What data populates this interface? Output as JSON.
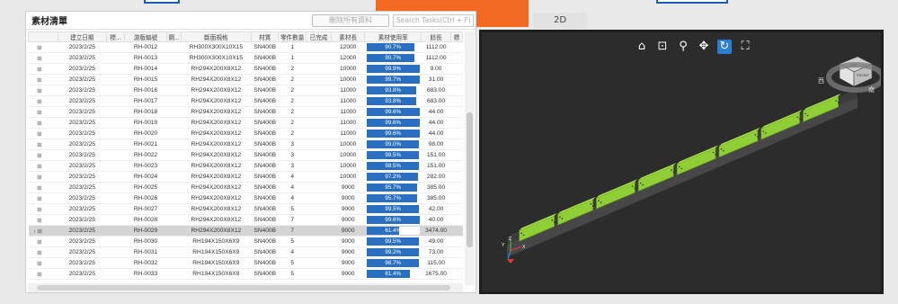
{
  "panel": {
    "title": "素材清單",
    "delete_button": "刪除所有資料",
    "search_placeholder": "Search Tasks(Ctrl + F)"
  },
  "columns": [
    "建立日期",
    "標...",
    "游版編號",
    "鋼...",
    "斷面規格",
    "材質",
    "零件數量",
    "已完成",
    "素材長",
    "素材使用率",
    "餘長",
    "標"
  ],
  "rows": [
    {
      "date": "2023/2/25",
      "id": "RH-0012",
      "spec": "RH300X300X10X15",
      "mat": "SN400B",
      "qty": "1",
      "len": "12000",
      "rate": "90.7%",
      "rate_value": 90.7,
      "rem": "1112.00"
    },
    {
      "date": "2023/2/25",
      "id": "RH-0013",
      "spec": "RH300X300X10X15",
      "mat": "SN400B",
      "qty": "1",
      "len": "12000",
      "rate": "90.7%",
      "rate_value": 90.7,
      "rem": "1112.00"
    },
    {
      "date": "2023/2/25",
      "id": "RH-0014",
      "spec": "RH294X200X8X12",
      "mat": "SN400B",
      "qty": "2",
      "len": "10000",
      "rate": "99.9%",
      "rate_value": 99.9,
      "rem": "9.00"
    },
    {
      "date": "2023/2/25",
      "id": "RH-0015",
      "spec": "RH294X200X8X12",
      "mat": "SN400B",
      "qty": "2",
      "len": "10000",
      "rate": "99.7%",
      "rate_value": 99.7,
      "rem": "31.00"
    },
    {
      "date": "2023/2/25",
      "id": "RH-0016",
      "spec": "RH294X200X8X12",
      "mat": "SN400B",
      "qty": "2",
      "len": "11000",
      "rate": "93.8%",
      "rate_value": 93.8,
      "rem": "683.00"
    },
    {
      "date": "2023/2/25",
      "id": "RH-0017",
      "spec": "RH294X200X8X12",
      "mat": "SN400B",
      "qty": "2",
      "len": "11000",
      "rate": "93.8%",
      "rate_value": 93.8,
      "rem": "683.00"
    },
    {
      "date": "2023/2/25",
      "id": "RH-0018",
      "spec": "RH294X200X8X12",
      "mat": "SN400B",
      "qty": "2",
      "len": "11000",
      "rate": "99.6%",
      "rate_value": 99.6,
      "rem": "44.00"
    },
    {
      "date": "2023/2/25",
      "id": "RH-0019",
      "spec": "RH294X200X8X12",
      "mat": "SN400B",
      "qty": "2",
      "len": "11000",
      "rate": "99.6%",
      "rate_value": 99.6,
      "rem": "44.00"
    },
    {
      "date": "2023/2/25",
      "id": "RH-0020",
      "spec": "RH294X200X8X12",
      "mat": "SN400B",
      "qty": "2",
      "len": "11000",
      "rate": "99.6%",
      "rate_value": 99.6,
      "rem": "44.00"
    },
    {
      "date": "2023/2/25",
      "id": "RH-0021",
      "spec": "RH294X200X8X12",
      "mat": "SN400B",
      "qty": "3",
      "len": "10000",
      "rate": "99.0%",
      "rate_value": 99.0,
      "rem": "98.00"
    },
    {
      "date": "2023/2/25",
      "id": "RH-0022",
      "spec": "RH294X200X8X12",
      "mat": "SN400B",
      "qty": "3",
      "len": "10000",
      "rate": "98.5%",
      "rate_value": 98.5,
      "rem": "151.00"
    },
    {
      "date": "2023/2/25",
      "id": "RH-0023",
      "spec": "RH294X200X8X12",
      "mat": "SN400B",
      "qty": "3",
      "len": "10000",
      "rate": "98.5%",
      "rate_value": 98.5,
      "rem": "151.00"
    },
    {
      "date": "2023/2/25",
      "id": "RH-0024",
      "spec": "RH294X200X8X12",
      "mat": "SN400B",
      "qty": "4",
      "len": "10000",
      "rate": "97.2%",
      "rate_value": 97.2,
      "rem": "282.00"
    },
    {
      "date": "2023/2/25",
      "id": "RH-0025",
      "spec": "RH294X200X8X12",
      "mat": "SN400B",
      "qty": "4",
      "len": "9000",
      "rate": "95.7%",
      "rate_value": 95.7,
      "rem": "385.00"
    },
    {
      "date": "2023/2/25",
      "id": "RH-0026",
      "spec": "RH294X200X8X12",
      "mat": "SN400B",
      "qty": "4",
      "len": "9000",
      "rate": "95.7%",
      "rate_value": 95.7,
      "rem": "385.00"
    },
    {
      "date": "2023/2/25",
      "id": "RH-0027",
      "spec": "RH294X200X8X12",
      "mat": "SN400B",
      "qty": "5",
      "len": "9000",
      "rate": "99.5%",
      "rate_value": 99.5,
      "rem": "42.00"
    },
    {
      "date": "2023/2/25",
      "id": "RH-0028",
      "spec": "RH294X200X8X12",
      "mat": "SN400B",
      "qty": "7",
      "len": "9000",
      "rate": "99.6%",
      "rate_value": 99.6,
      "rem": "40.00"
    },
    {
      "date": "2023/2/25",
      "id": "RH-0029",
      "spec": "RH294X200X8X12",
      "mat": "SN400B",
      "qty": "7",
      "len": "9000",
      "rate": "61.4%",
      "rate_value": 61.4,
      "rem": "3474.00",
      "selected": true
    },
    {
      "date": "2023/2/25",
      "id": "RH-0030",
      "spec": "RH194X150X6X9",
      "mat": "SN400B",
      "qty": "5",
      "len": "9000",
      "rate": "99.5%",
      "rate_value": 99.5,
      "rem": "49.00"
    },
    {
      "date": "2023/2/25",
      "id": "RH-0031",
      "spec": "RH194X150X6X9",
      "mat": "SN400B",
      "qty": "4",
      "len": "9000",
      "rate": "99.2%",
      "rate_value": 99.2,
      "rem": "73.00"
    },
    {
      "date": "2023/2/25",
      "id": "RH-0032",
      "spec": "RH194X150X6X9",
      "mat": "SN400B",
      "qty": "5",
      "len": "9000",
      "rate": "98.7%",
      "rate_value": 98.7,
      "rem": "115.00"
    },
    {
      "date": "2023/2/25",
      "id": "RH-0033",
      "spec": "RH194X150X6X9",
      "mat": "SN400B",
      "qty": "5",
      "len": "9000",
      "rate": "81.4%",
      "rate_value": 81.4,
      "rem": "1675.00"
    }
  ],
  "viewer": {
    "tab_label": "2D",
    "toolbar": [
      "home-icon",
      "zoom-window-icon",
      "zoom-icon",
      "pan-icon",
      "rotate-icon",
      "fullscreen-icon"
    ],
    "nav_cube": {
      "top": "TOP",
      "front": "FRONT",
      "west": "西",
      "south": "南"
    },
    "axes": {
      "y": "Y",
      "z": "Z",
      "x": "X"
    }
  },
  "colors": {
    "accent": "#2a6fbf",
    "beam_green": "#8fce34",
    "orange": "#f26a22"
  }
}
